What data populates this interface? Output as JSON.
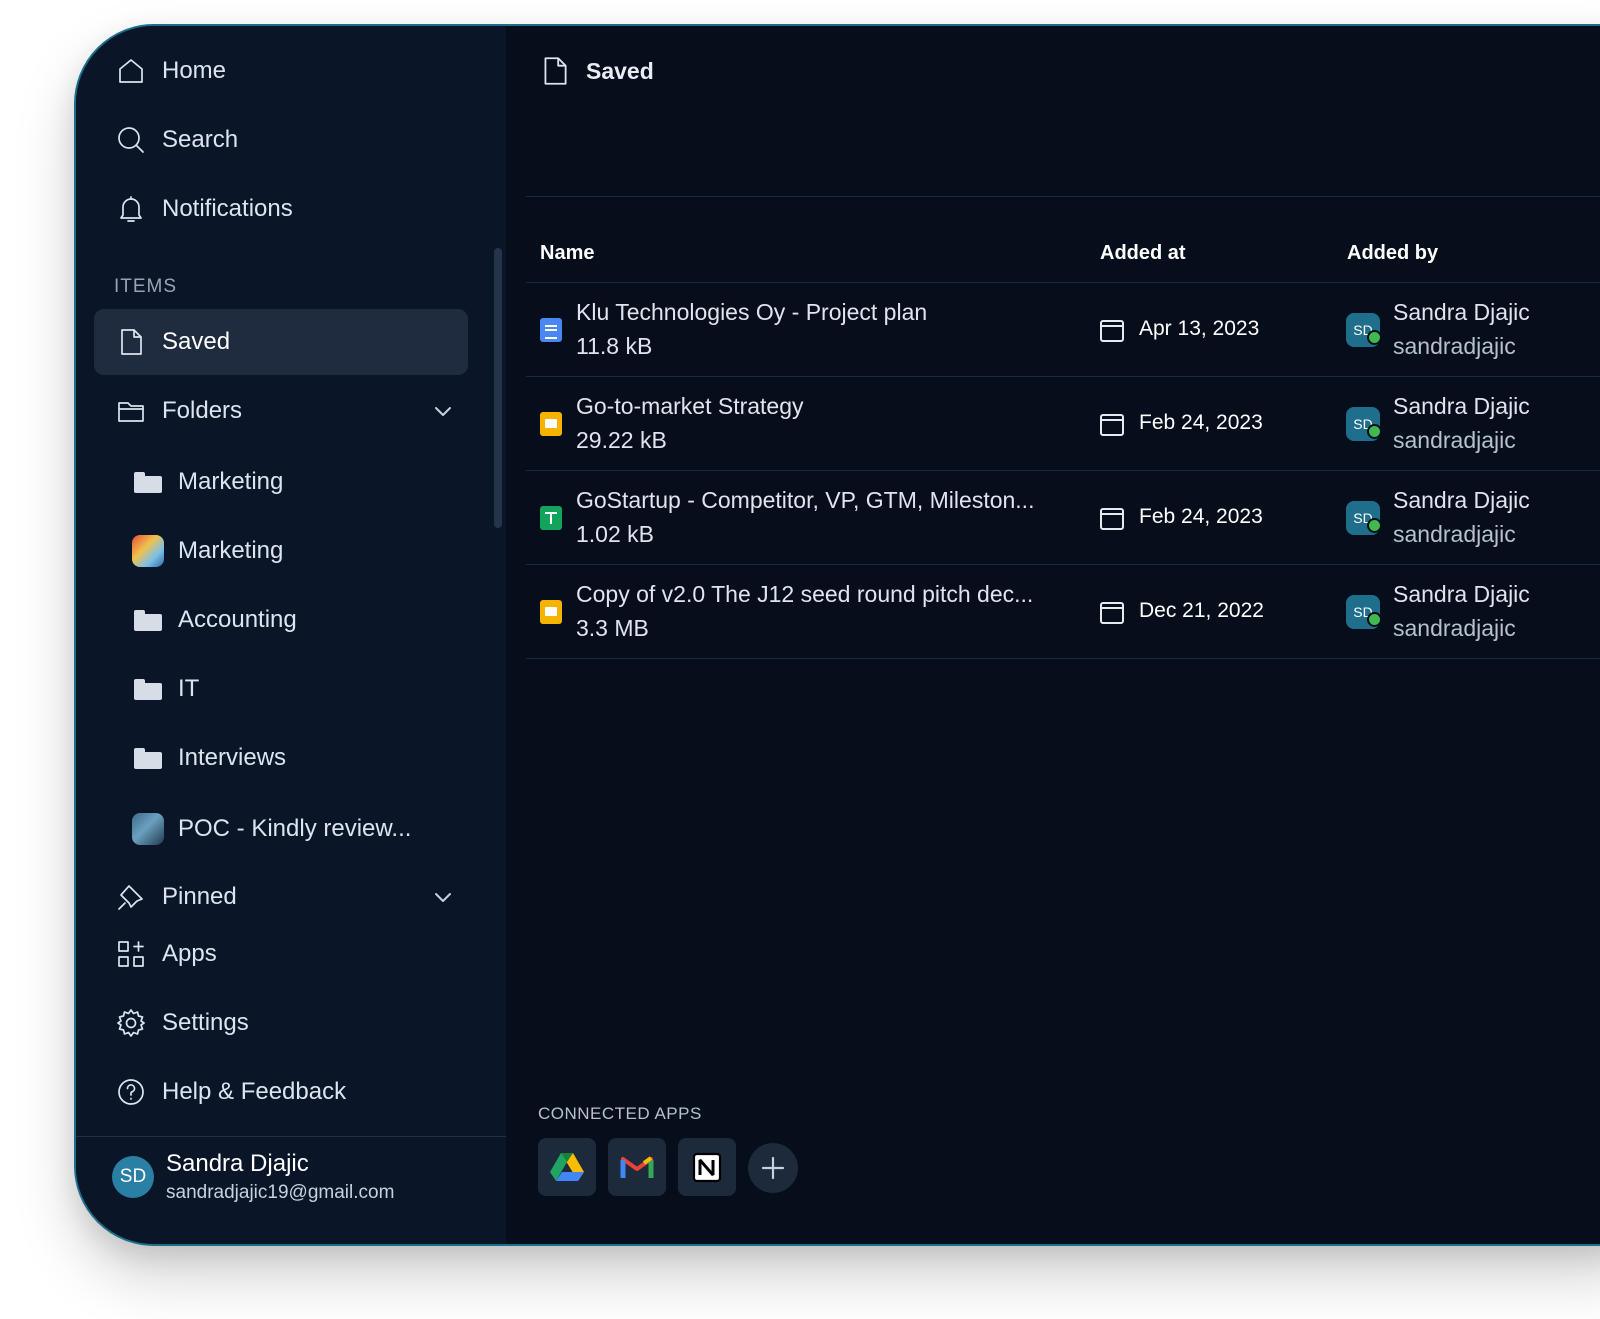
{
  "sidebar": {
    "nav": [
      {
        "label": "Home",
        "icon": "home-icon"
      },
      {
        "label": "Search",
        "icon": "search-icon"
      },
      {
        "label": "Notifications",
        "icon": "bell-icon"
      }
    ],
    "section_label": "ITEMS",
    "saved_label": "Saved",
    "folders_label": "Folders",
    "folders": [
      {
        "label": "Marketing",
        "icon": "folder-icon"
      },
      {
        "label": "Marketing",
        "icon": "funky-thumbnail-icon"
      },
      {
        "label": "Accounting",
        "icon": "folder-icon"
      },
      {
        "label": "IT",
        "icon": "folder-icon"
      },
      {
        "label": "Interviews",
        "icon": "folder-icon"
      },
      {
        "label": "POC - Kindly review...",
        "icon": "poc-thumbnail-icon"
      }
    ],
    "pinned_label": "Pinned",
    "apps_label": "Apps",
    "settings_label": "Settings",
    "help_label": "Help & Feedback",
    "user": {
      "initials": "SD",
      "name": "Sandra Djajic",
      "email": "sandradjajic19@gmail.com"
    }
  },
  "main": {
    "title": "Saved",
    "columns": [
      "Name",
      "Added at",
      "Added by"
    ],
    "rows": [
      {
        "name": "Klu Technologies Oy - Project plan",
        "size": "11.8 kB",
        "type": "doc",
        "date": "Apr 13, 2023",
        "by_initials": "SD",
        "by_name": "Sandra Djajic",
        "by_user": "sandradjajic"
      },
      {
        "name": "Go-to-market Strategy",
        "size": "29.22 kB",
        "type": "slides",
        "date": "Feb 24, 2023",
        "by_initials": "SD",
        "by_name": "Sandra Djajic",
        "by_user": "sandradjajic"
      },
      {
        "name": "GoStartup - Competitor, VP, GTM, Mileston...",
        "size": "1.02 kB",
        "type": "sheet",
        "date": "Feb 24, 2023",
        "by_initials": "SD",
        "by_name": "Sandra Djajic",
        "by_user": "sandradjajic"
      },
      {
        "name": "Copy of v2.0 The J12 seed round pitch dec...",
        "size": "3.3 MB",
        "type": "slides",
        "date": "Dec 21, 2022",
        "by_initials": "SD",
        "by_name": "Sandra Djajic",
        "by_user": "sandradjajic"
      }
    ],
    "connected_apps_label": "CONNECTED APPS",
    "connected_apps": [
      "google-drive-icon",
      "gmail-icon",
      "notion-icon"
    ]
  },
  "colors": {
    "background": "#050e1a",
    "sidebar": "#0a1628",
    "active_item": "#1f2c40",
    "accent_border": "#1c6f8c",
    "online": "#3fb950"
  }
}
